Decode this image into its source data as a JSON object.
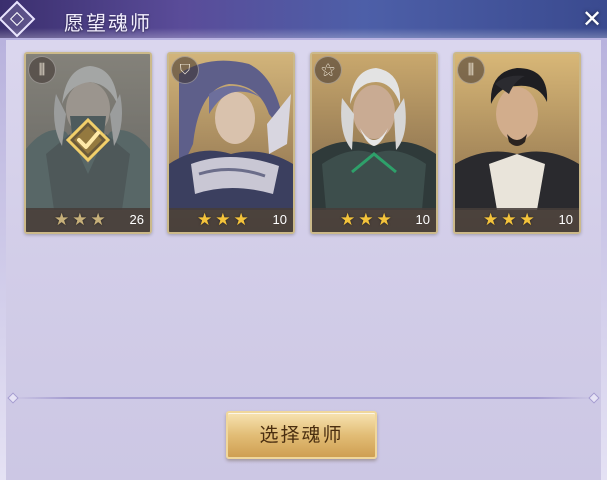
{
  "dialog": {
    "title": "愿望魂师",
    "close_icon": "close-icon",
    "title_icon": "diamond-emblem-icon"
  },
  "cards": [
    {
      "class_icon": "tuning-fork-icon",
      "class_glyph": "⫼",
      "stars": "★★★",
      "star_count": 3,
      "level": "26",
      "selected": true
    },
    {
      "class_icon": "shield-icon",
      "class_glyph": "⛉",
      "stars": "★★★",
      "star_count": 3,
      "level": "10",
      "selected": false
    },
    {
      "class_icon": "bird-icon",
      "class_glyph": "⚝",
      "stars": "★★★",
      "star_count": 3,
      "level": "10",
      "selected": false
    },
    {
      "class_icon": "tuning-fork-icon",
      "class_glyph": "⫼",
      "stars": "★★★",
      "star_count": 3,
      "level": "10",
      "selected": false
    }
  ],
  "select_button": {
    "label": "选择魂师"
  },
  "colors": {
    "star": "#f4c33b",
    "title_bar": "#4d5fa8",
    "button": "#e2bd76",
    "check_badge": "#e3b54a"
  }
}
